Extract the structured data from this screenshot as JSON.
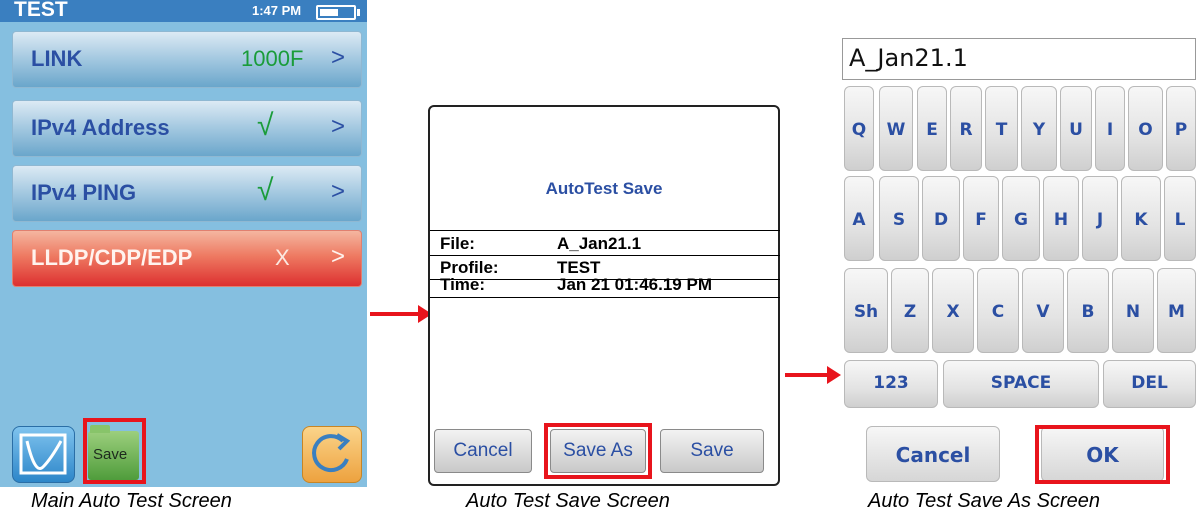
{
  "main": {
    "status": {
      "title": "TEST",
      "time": "1:47 PM",
      "battery_level": 0.55
    },
    "rows": [
      {
        "label": "LINK",
        "value": "1000F",
        "value_color": "#1a9c3a",
        "arrow": ">"
      },
      {
        "label": "IPv4 Address",
        "value": "√",
        "value_color": "#1a9c3a",
        "arrow": ">"
      },
      {
        "label": "IPv4 PING",
        "value": "√",
        "value_color": "#1a9c3a",
        "arrow": ">"
      },
      {
        "label": "LLDP/CDP/EDP",
        "value": "X",
        "value_color": "#fbe8e0",
        "arrow": ">"
      }
    ],
    "buttons": {
      "graph_icon": "graph-icon",
      "save_label": "Save",
      "refresh_icon": "refresh-icon"
    },
    "caption": "Main Auto Test Screen"
  },
  "save_dialog": {
    "title": "AutoTest Save",
    "fields": [
      {
        "key": "File:",
        "value": "A_Jan21.1"
      },
      {
        "key": "Profile:",
        "value": "TEST"
      },
      {
        "key": "Time:",
        "value": "Jan 21 01:46.19 PM"
      }
    ],
    "buttons": {
      "cancel": "Cancel",
      "save_as": "Save As",
      "save": "Save"
    },
    "caption": "Auto Test Save Screen"
  },
  "save_as": {
    "filename": "A_Jan21.1",
    "keys": {
      "row1": [
        "Q",
        "W",
        "E",
        "R",
        "T",
        "Y",
        "U",
        "I",
        "O",
        "P"
      ],
      "row2": [
        "A",
        "S",
        "D",
        "F",
        "G",
        "H",
        "J",
        "K",
        "L"
      ],
      "row3": [
        "Sh",
        "Z",
        "X",
        "C",
        "V",
        "B",
        "N",
        "M"
      ],
      "row4": [
        "123",
        "SPACE",
        "DEL"
      ]
    },
    "buttons": {
      "cancel": "Cancel",
      "ok": "OK"
    },
    "caption": "Auto Test Save As Screen"
  },
  "colors": {
    "highlight": "#e8141c",
    "label_blue": "#2b4fa3",
    "status_ok": "#1a9c3a"
  }
}
